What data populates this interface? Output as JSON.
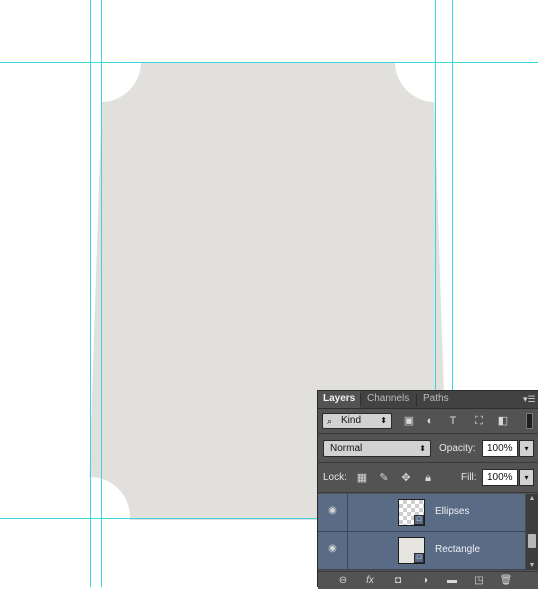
{
  "colors": {
    "guide": "#39d5e0",
    "card_fill": "#e1e0dd",
    "panel_bg": "#535353",
    "selected_row": "#596b85"
  },
  "panel": {
    "tabs": [
      {
        "label": "Layers",
        "active": true
      },
      {
        "label": "Channels",
        "active": false
      },
      {
        "label": "Paths",
        "active": false
      }
    ],
    "menu_icon": "panel-menu-icon",
    "filter": {
      "kind_label": "Kind",
      "icons": [
        "image-filter-icon",
        "adjustment-filter-icon",
        "type-filter-icon",
        "shape-filter-icon",
        "smart-object-filter-icon"
      ]
    },
    "blend_mode": "Normal",
    "opacity_label": "Opacity:",
    "opacity_value": "100%",
    "lock_label": "Lock:",
    "lock_icons": [
      "lock-transparent-icon",
      "lock-image-icon",
      "lock-position-icon",
      "lock-all-icon"
    ],
    "fill_label": "Fill:",
    "fill_value": "100%",
    "layers": [
      {
        "name": "Ellipses",
        "thumbnail": "transparent",
        "selected": true
      },
      {
        "name": "Rectangle",
        "thumbnail": "solid",
        "selected": true
      }
    ],
    "bottom_icons": [
      "link-layers-icon",
      "fx-icon",
      "add-mask-icon",
      "adjustment-layer-icon",
      "new-group-icon",
      "new-layer-icon",
      "delete-icon"
    ],
    "fx_glyph": "fx",
    "link_glyph": "⊖"
  }
}
